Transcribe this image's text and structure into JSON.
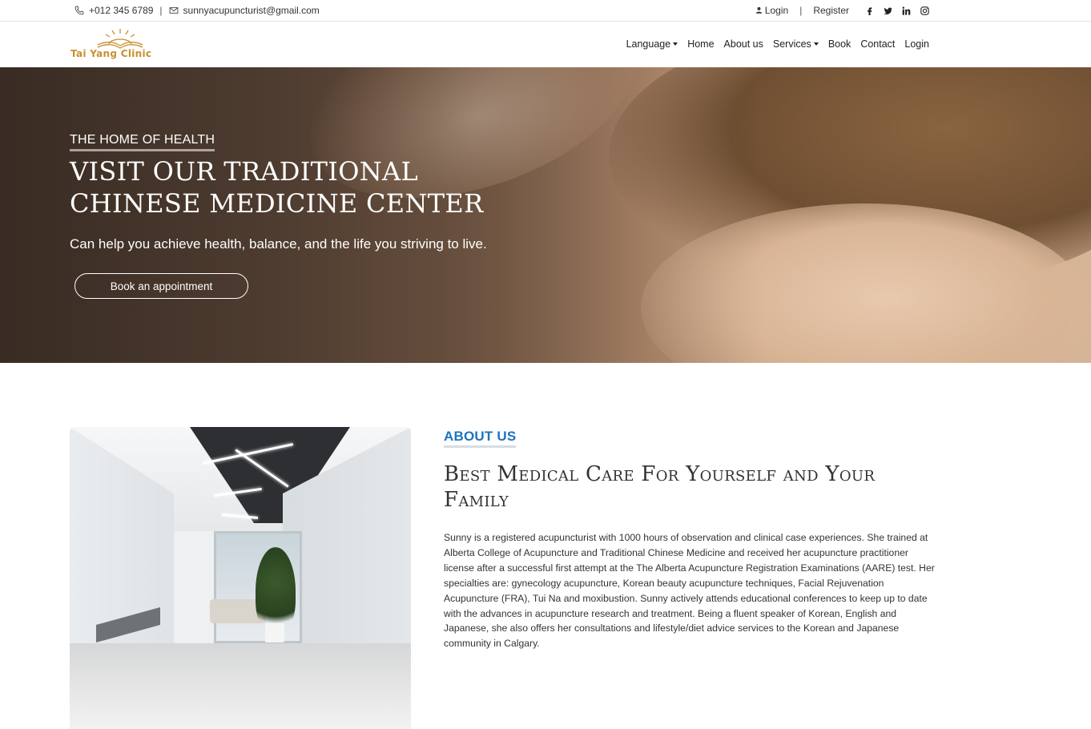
{
  "topbar": {
    "phone": "+012 345 6789",
    "divider": "|",
    "email": "sunnyacupuncturist@gmail.com",
    "login": "Login",
    "register": "Register",
    "social_icons": [
      "facebook-icon",
      "twitter-icon",
      "linkedin-icon",
      "instagram-icon"
    ]
  },
  "logo": {
    "text": "Tai Yang Clinic",
    "color": "#c7902f"
  },
  "nav": {
    "items": [
      {
        "label": "Language",
        "dropdown": true
      },
      {
        "label": "Home",
        "dropdown": false
      },
      {
        "label": "About us",
        "dropdown": false
      },
      {
        "label": "Services",
        "dropdown": true
      },
      {
        "label": "Book",
        "dropdown": false
      },
      {
        "label": "Contact",
        "dropdown": false
      },
      {
        "label": "Login",
        "dropdown": false
      }
    ]
  },
  "hero": {
    "eyebrow": "THE HOME OF HEALTH",
    "title_line1": "VISIT OUR TRADITIONAL",
    "title_line2": "CHINESE MEDICINE CENTER",
    "subtitle": "Can help you achieve health, balance, and the life you striving to live.",
    "button": "Book an appointment"
  },
  "about": {
    "tag": "ABOUT US",
    "tag_color": "#1e73be",
    "title": "Best Medical Care For Yourself and Your Family",
    "body": "Sunny is a registered acupuncturist with 1000 hours of observation and clinical case experiences. She trained at Alberta College of Acupuncture and Traditional Chinese Medicine and received her acupuncture practitioner license after a successful first attempt at the The Alberta Acupuncture Registration Examinations (AARE) test. Her specialties are: gynecology acupuncture, Korean beauty acupuncture techniques, Facial Rejuvenation Acupuncture (FRA), Tui Na and moxibustion. Sunny actively attends educational conferences to keep up to date with the advances in acupuncture research and treatment. Being a fluent speaker of Korean, English and Japanese, she also offers her consultations and lifestyle/diet advice services to the Korean and Japanese community in Calgary."
  }
}
